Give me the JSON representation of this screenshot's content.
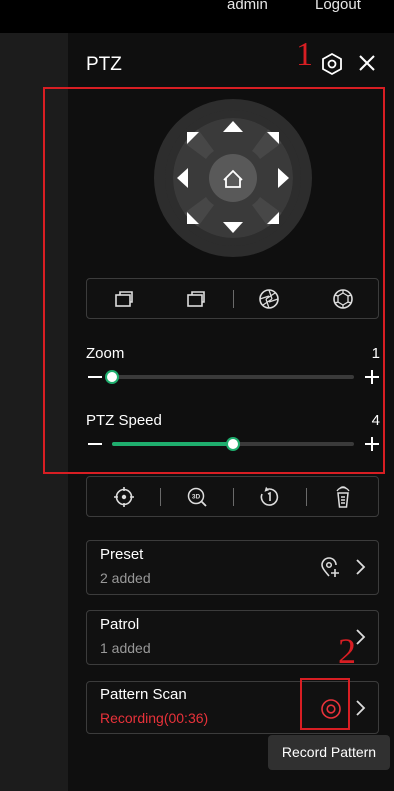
{
  "topbar": {
    "user": "admin",
    "logout": "Logout"
  },
  "panel": {
    "title": "PTZ",
    "markers": {
      "one": "1",
      "two": "2"
    },
    "zoom": {
      "label": "Zoom",
      "value": "1",
      "level_fraction": 0.0
    },
    "speed": {
      "label": "PTZ Speed",
      "value": "4",
      "level_fraction": 0.5
    },
    "cards": {
      "preset": {
        "title": "Preset",
        "subtitle": "2 added"
      },
      "patrol": {
        "title": "Patrol",
        "subtitle": "1 added"
      },
      "pattern": {
        "title": "Pattern Scan",
        "subtitle": "Recording(00:36)"
      }
    },
    "tooltip": "Record Pattern"
  },
  "colors": {
    "accent": "#1fae6e",
    "annotation": "#d81e23",
    "recording": "#e8323a"
  }
}
